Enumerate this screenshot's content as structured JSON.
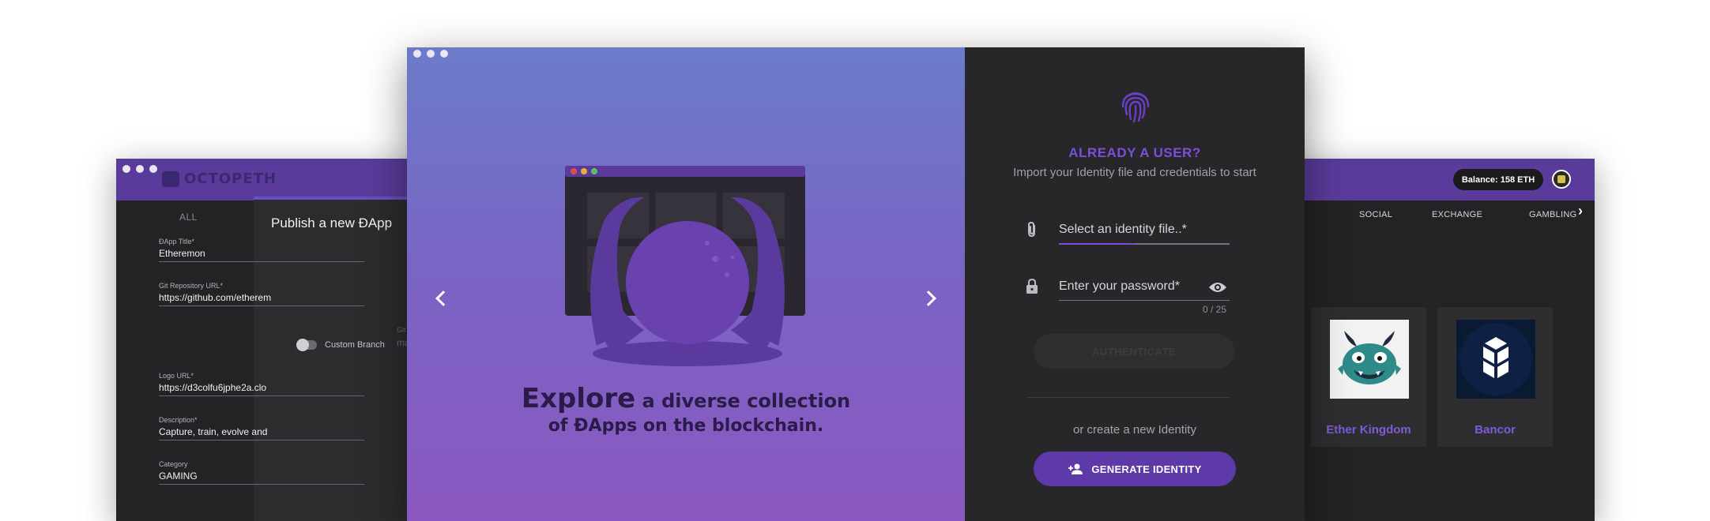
{
  "back_window": {
    "brand": "OCTOPETH",
    "category_all": "ALL",
    "balance": "Balance: 158 ETH",
    "categories": [
      "SOCIAL",
      "EXCHANGE",
      "GAMBLING"
    ],
    "cards": [
      {
        "name": "Ether Kingdom",
        "icon": "monster-logo"
      },
      {
        "name": "Bancor",
        "icon": "bancor-logo"
      }
    ]
  },
  "publish_form": {
    "title": "Publish a new ÐApp",
    "fields": {
      "dapp_title": {
        "label": "ÐApp Title*",
        "value": "Etheremon"
      },
      "git_url": {
        "label": "Git Repository URL*",
        "value": "https://github.com/etherem"
      },
      "custom_branch": {
        "label": "Custom Branch",
        "git_label": "Git",
        "git_value": "ma"
      },
      "logo_url": {
        "label": "Logo URL*",
        "value": "https://d3colfu6jphe2a.clo"
      },
      "description": {
        "label": "Description*",
        "value": "Capture, train, evolve and"
      },
      "category": {
        "label": "Category",
        "value": "GAMING"
      }
    }
  },
  "hero": {
    "headline_emph": "Explore",
    "headline_rest": " a diverse collection",
    "headline_line2": "of ÐApps on the blockchain."
  },
  "login": {
    "title": "ALREADY A USER?",
    "subtitle": "Import your Identity file and credentials to start",
    "identity_placeholder": "Select an identity file..*",
    "password_placeholder": "Enter your password*",
    "password_counter": "0 / 25",
    "authenticate_label": "AUTHENTICATE",
    "or_text": "or create a new Identity",
    "generate_label": "GENERATE IDENTITY"
  },
  "colors": {
    "accent": "#5e3aa8",
    "link": "#7d4fd8",
    "panel": "#272628"
  }
}
